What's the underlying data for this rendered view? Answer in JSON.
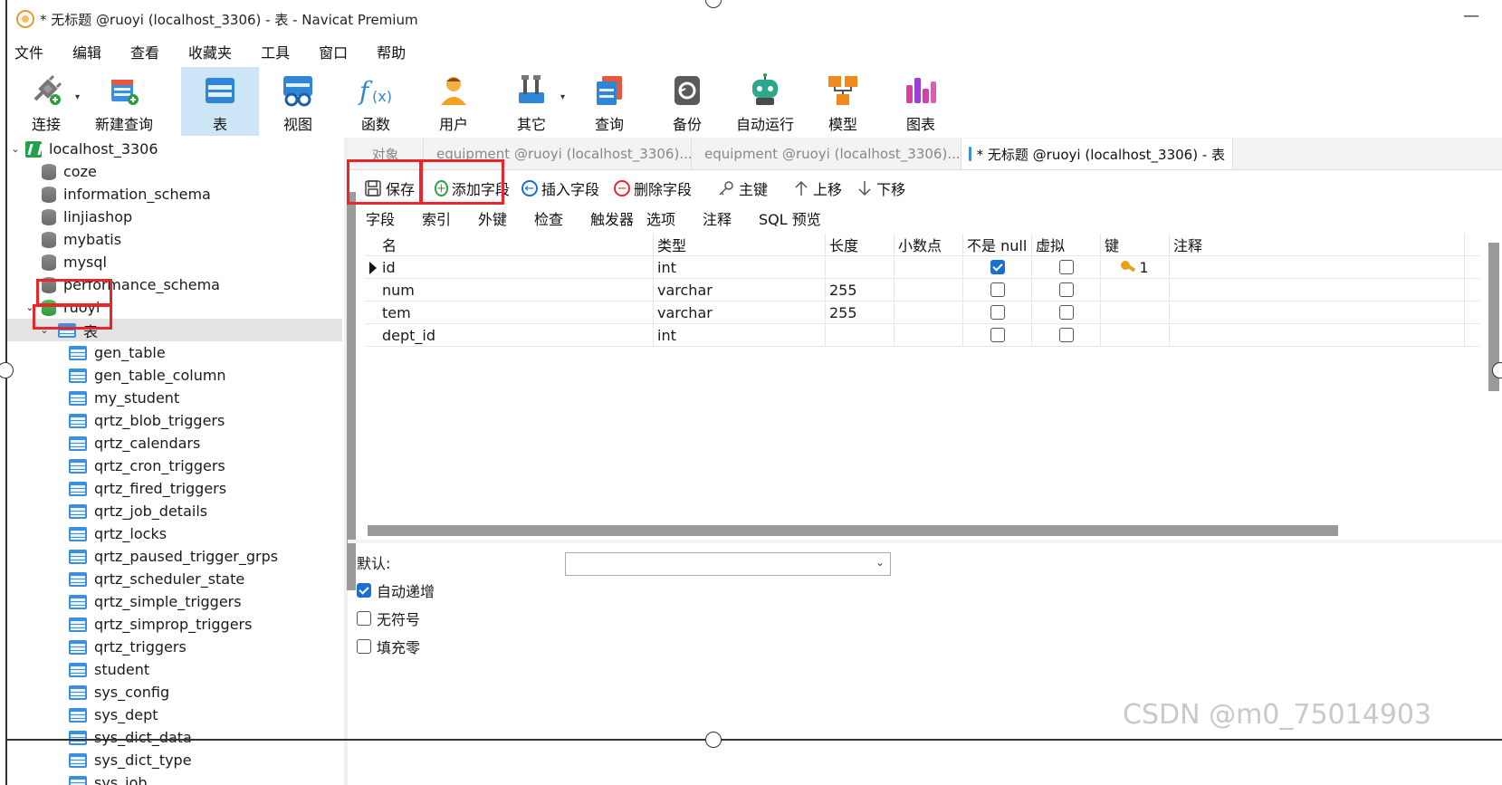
{
  "window": {
    "title": "* 无标题 @ruoyi (localhost_3306) - 表 - Navicat Premium",
    "minimize": "—"
  },
  "menu": [
    "文件",
    "编辑",
    "查看",
    "收藏夹",
    "工具",
    "窗口",
    "帮助"
  ],
  "toolbar": [
    {
      "label": "连接",
      "icon": "plug-icon",
      "dropdown": true
    },
    {
      "label": "新建查询",
      "icon": "new-query-icon"
    },
    {
      "label": "表",
      "icon": "table-icon",
      "active": true
    },
    {
      "label": "视图",
      "icon": "view-icon"
    },
    {
      "label": "函数",
      "icon": "function-icon"
    },
    {
      "label": "用户",
      "icon": "user-icon"
    },
    {
      "label": "其它",
      "icon": "tools-icon",
      "dropdown": true
    },
    {
      "label": "查询",
      "icon": "query-icon"
    },
    {
      "label": "备份",
      "icon": "backup-icon"
    },
    {
      "label": "自动运行",
      "icon": "robot-icon"
    },
    {
      "label": "模型",
      "icon": "model-icon"
    },
    {
      "label": "图表",
      "icon": "chart-icon"
    }
  ],
  "tree": {
    "connection": "localhost_3306",
    "databases": [
      "coze",
      "information_schema",
      "linjiashop",
      "mybatis",
      "mysql",
      "performance_schema"
    ],
    "open_db": "ruoyi",
    "tables_node": "表",
    "tables": [
      "gen_table",
      "gen_table_column",
      "my_student",
      "qrtz_blob_triggers",
      "qrtz_calendars",
      "qrtz_cron_triggers",
      "qrtz_fired_triggers",
      "qrtz_job_details",
      "qrtz_locks",
      "qrtz_paused_trigger_grps",
      "qrtz_scheduler_state",
      "qrtz_simple_triggers",
      "qrtz_simprop_triggers",
      "qrtz_triggers",
      "student",
      "sys_config",
      "sys_dept",
      "sys_dict_data",
      "sys_dict_type",
      "sys_job"
    ]
  },
  "tabs": [
    {
      "label": "对象",
      "active": false
    },
    {
      "label": "equipment @ruoyi (localhost_3306)...",
      "active": false
    },
    {
      "label": "equipment @ruoyi (localhost_3306)...",
      "active": false
    },
    {
      "label": "* 无标题 @ruoyi (localhost_3306) - 表",
      "active": true
    }
  ],
  "actions": [
    {
      "label": "保存",
      "icon": "save-icon"
    },
    {
      "label": "添加字段",
      "icon": "add-field-icon",
      "color": "#2e9e3c"
    },
    {
      "label": "插入字段",
      "icon": "insert-field-icon",
      "color": "#1a6fd0"
    },
    {
      "label": "删除字段",
      "icon": "delete-field-icon",
      "color": "#e8262b"
    },
    {
      "label": "主键",
      "icon": "key-icon"
    },
    {
      "label": "上移",
      "icon": "arrow-up-icon"
    },
    {
      "label": "下移",
      "icon": "arrow-down-icon"
    }
  ],
  "subtabs": [
    "字段",
    "索引",
    "外键",
    "检查",
    "触发器",
    "选项",
    "注释",
    "SQL 预览"
  ],
  "grid": {
    "headers": {
      "name": "名",
      "type": "类型",
      "length": "长度",
      "decimals": "小数点",
      "not_null": "不是 null",
      "virtual": "虚拟",
      "key": "键",
      "comment": "注释"
    },
    "rows": [
      {
        "name": "id",
        "type": "int",
        "length": "",
        "decimals": "",
        "not_null": true,
        "virtual": false,
        "key": "1",
        "comment": "",
        "current": true
      },
      {
        "name": "num",
        "type": "varchar",
        "length": "255",
        "decimals": "",
        "not_null": false,
        "virtual": false,
        "key": "",
        "comment": ""
      },
      {
        "name": "tem",
        "type": "varchar",
        "length": "255",
        "decimals": "",
        "not_null": false,
        "virtual": false,
        "key": "",
        "comment": ""
      },
      {
        "name": "dept_id",
        "type": "int",
        "length": "",
        "decimals": "",
        "not_null": false,
        "virtual": false,
        "key": "",
        "comment": ""
      }
    ]
  },
  "props": {
    "default_label": "默认:",
    "default_value": "",
    "checks": [
      {
        "label": "自动递增",
        "checked": true
      },
      {
        "label": "无符号",
        "checked": false
      },
      {
        "label": "填充零",
        "checked": false
      }
    ]
  },
  "watermark": "CSDN @m0_75014903",
  "colors": {
    "highlight": "#e8262b",
    "accent": "#1a6fd0",
    "active_tool": "#cde6f7"
  }
}
